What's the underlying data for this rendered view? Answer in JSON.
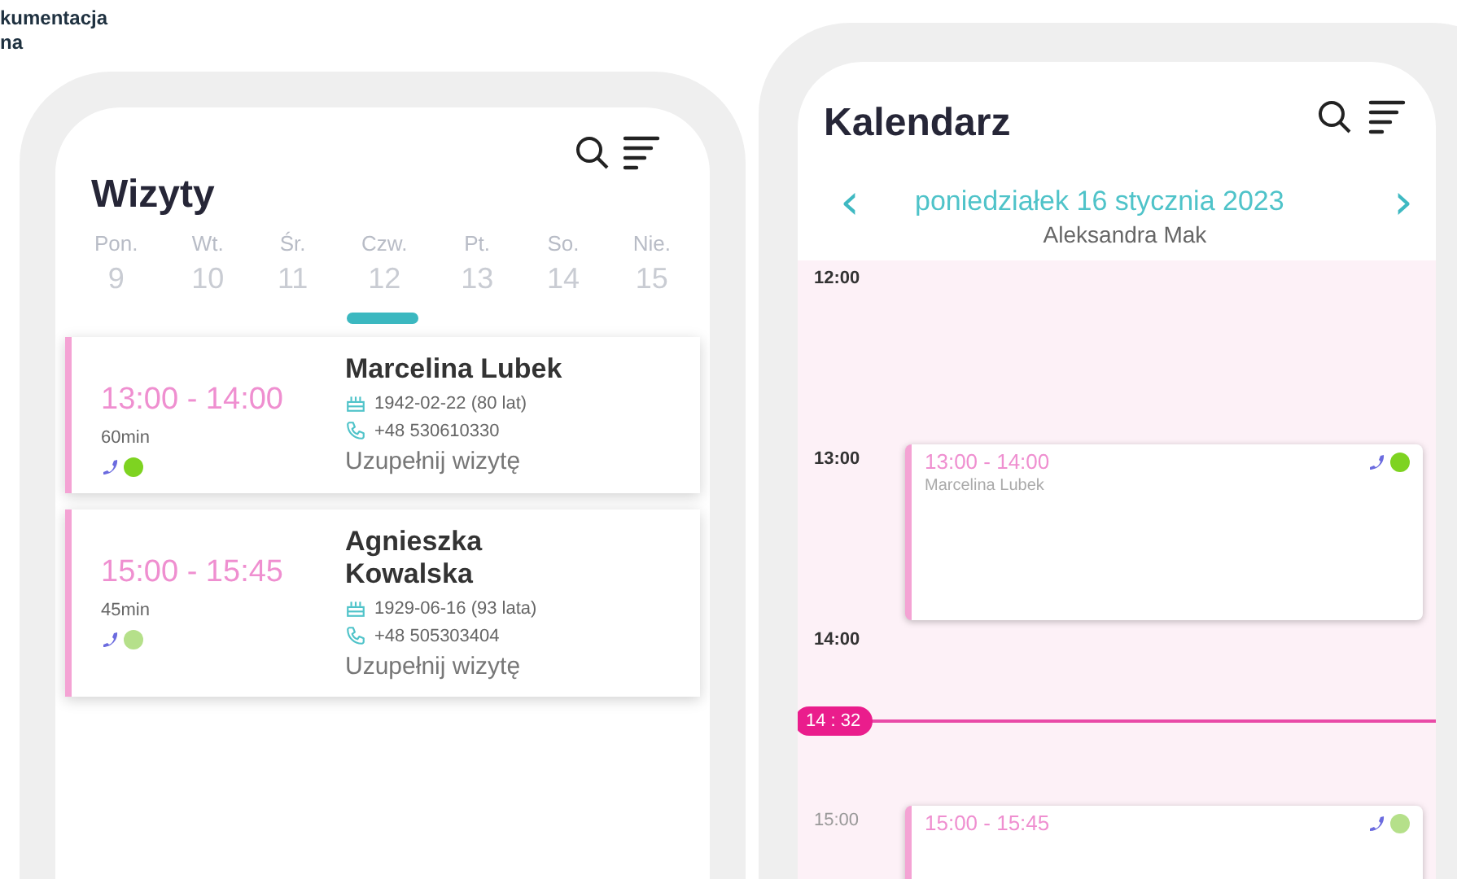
{
  "logo": {
    "lines": [
      "kumentacja",
      "na"
    ]
  },
  "visits_screen": {
    "title": "Wizyty",
    "days": [
      {
        "name": "Pon.",
        "date": "9"
      },
      {
        "name": "Wt.",
        "date": "10"
      },
      {
        "name": "Śr.",
        "date": "11"
      },
      {
        "name": "Czw.",
        "date": "12"
      },
      {
        "name": "Pt.",
        "date": "13"
      },
      {
        "name": "So.",
        "date": "14"
      },
      {
        "name": "Nie.",
        "date": "15"
      }
    ],
    "visits": [
      {
        "time": "13:00 - 14:00",
        "duration": "60min",
        "name": "Marcelina Lubek",
        "birth": "1942-02-22 (80 lat)",
        "phone": "+48 530610330",
        "action": "Uzupełnij wizytę",
        "color": "#7ed321"
      },
      {
        "time": "15:00 - 15:45",
        "duration": "45min",
        "name": "Agnieszka Kowalska",
        "birth": "1929-06-16 (93 lata)",
        "phone": "+48 505303404",
        "action": "Uzupełnij wizytę",
        "color": "#b5e08a"
      }
    ]
  },
  "calendar_screen": {
    "title": "Kalendarz",
    "prev": "‹",
    "date": "poniedziałek  16 stycznia 2023",
    "next": "›",
    "person": "Aleksandra  Mak",
    "hours": [
      {
        "label": "12:00"
      },
      {
        "label": "13:00",
        "events": [
          {
            "time": "13:00 - 14:00",
            "name": "Marcelina Lubek",
            "color": "#7ed321"
          }
        ]
      },
      {
        "label": "14:00",
        "now": "14 : 32"
      },
      {
        "label": "15:00",
        "events": [
          {
            "time": "15:00 - 15:45",
            "color": "#b5e08a"
          }
        ]
      }
    ]
  }
}
